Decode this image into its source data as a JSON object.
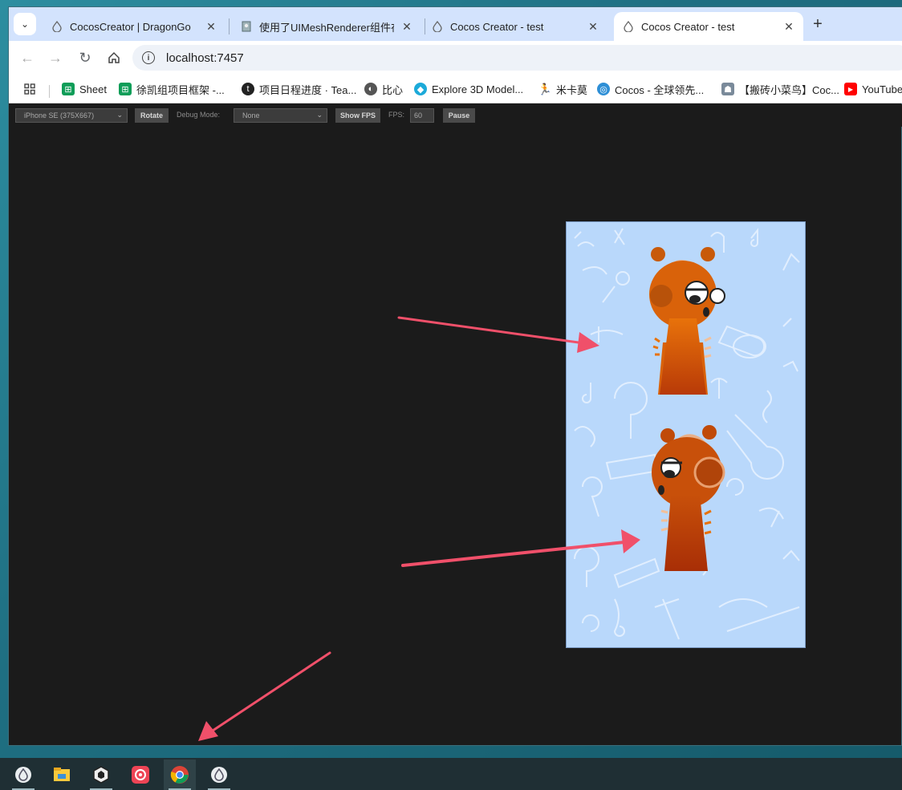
{
  "tabs": [
    {
      "title": "CocosCreator | DragonGo",
      "icon": "cocos-icon",
      "active": false
    },
    {
      "title": "使用了UIMeshRenderer组件在",
      "icon": "page-icon",
      "active": false
    },
    {
      "title": "Cocos Creator - test",
      "icon": "cocos-icon",
      "active": false
    },
    {
      "title": "Cocos Creator - test",
      "icon": "cocos-icon",
      "active": true
    }
  ],
  "address": {
    "url": "localhost:7457"
  },
  "bookmarks": [
    {
      "label": "Sheet",
      "icon": "sheet-icon",
      "color": "#0f9d58"
    },
    {
      "label": "徐凯组项目框架 -...",
      "icon": "sheet-icon",
      "color": "#0f9d58"
    },
    {
      "label": "项目日程进度 · Tea...",
      "icon": "teambition-icon",
      "color": "#222222"
    },
    {
      "label": "比心",
      "icon": "globe-icon",
      "color": "#555555"
    },
    {
      "label": "Explore 3D Model...",
      "icon": "3d-icon",
      "color": "#1caad9"
    },
    {
      "label": "米卡莫",
      "icon": "runner-icon",
      "color": "#f58220"
    },
    {
      "label": "Cocos - 全球领先...",
      "icon": "cocos-icon",
      "color": "#2e8fd6"
    },
    {
      "label": "【搬砖小菜鸟】Coc...",
      "icon": "robot-icon",
      "color": "#7a8a9a"
    },
    {
      "label": "YouTube",
      "icon": "youtube-icon",
      "color": "#ff0000"
    }
  ],
  "preview": {
    "device": "iPhone SE (375X667)",
    "rotate": "Rotate",
    "debug_label": "Debug Mode:",
    "debug_value": "None",
    "show_fps": "Show FPS",
    "fps_label": "FPS:",
    "fps_value": "60",
    "pause": "Pause"
  },
  "taskbar": [
    {
      "icon": "cocos-dashboard-icon"
    },
    {
      "icon": "file-explorer-icon"
    },
    {
      "icon": "unity-icon"
    },
    {
      "icon": "app-icon"
    },
    {
      "icon": "chrome-icon",
      "active": true
    },
    {
      "icon": "cocos-creator-icon"
    }
  ],
  "colors": {
    "accent_arrow": "#f0506a",
    "game_bg": "#b9d8fb",
    "character": "#d9620a"
  }
}
